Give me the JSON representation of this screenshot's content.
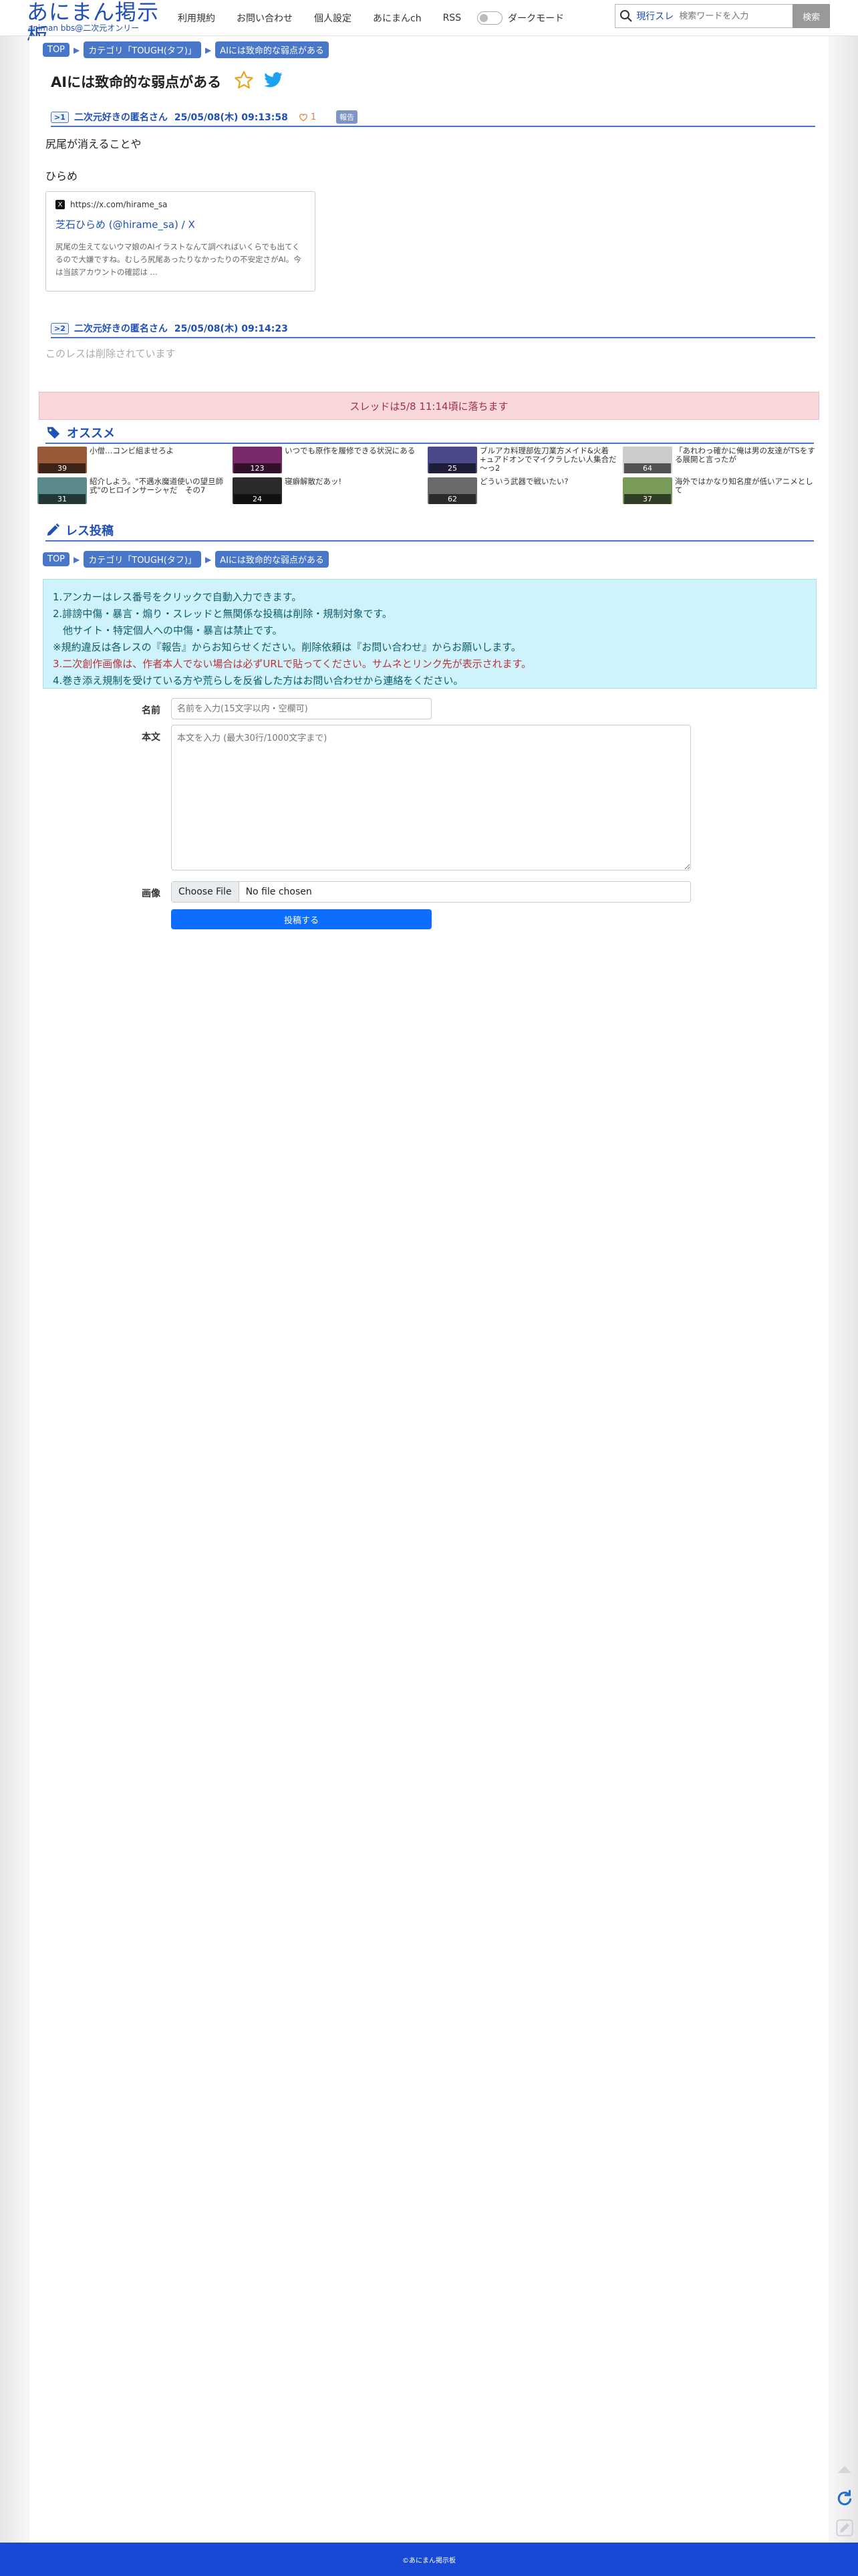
{
  "site": {
    "logo_main": "あにまん掲示板",
    "logo_sub": "animan bbs@二次元オンリー",
    "nav": [
      "利用規約",
      "お問い合わせ",
      "個人設定",
      "あにまんch",
      "RSS"
    ],
    "dark_mode_label": "ダークモード",
    "search": {
      "scope": "現行スレ",
      "placeholder": "検索ワードを入力",
      "button": "検索"
    }
  },
  "breadcrumb": [
    "TOP",
    "カテゴリ「TOUGH(タフ)」",
    "AIには致命的な弱点がある"
  ],
  "thread": {
    "title": "AIには致命的な弱点がある",
    "icons": {
      "favorite": "star-icon",
      "share": "twitter-icon"
    },
    "accent_color": "#4876c8"
  },
  "posts": [
    {
      "num": ">1",
      "author": "二次元好きの匿名さん",
      "date": "25/05/08(木) 09:13:58",
      "likes": "1",
      "report_label": "報告",
      "body_lines": [
        "尻尾が消えることや",
        "ひらめ"
      ],
      "card": {
        "url": "https://x.com/hirame_sa",
        "url_icon": "X",
        "title": "芝石ひらめ (@hirame_sa) / X",
        "desc": "尻尾の生えてないウマ娘のAIイラストなんて調べればいくらでも出てくるので大嫌ですね。むしろ尻尾あったりなかったりの不安定さがAI。今は当該アカウントの確認は ..."
      }
    },
    {
      "num": ">2",
      "author": "二次元好きの匿名さん",
      "date": "25/05/08(木) 09:14:23",
      "deleted": "このレスは削除されています"
    }
  ],
  "notice": "スレッドは5/8 11:14頃に落ちます",
  "recommend": {
    "title": "オススメ",
    "items": [
      {
        "text": "小僧…コンビ組ませろよ",
        "count": "39",
        "color": "#9a5a3a"
      },
      {
        "text": "いつでも原作を履修できる状況にある",
        "count": "123",
        "color": "#7a2a6a"
      },
      {
        "text": "ブルアカ料理部佐刀業方メイド&火着+ュアドオンでマイクラしたい人集合だ～っ2",
        "count": "25",
        "color": "#4a4a8a"
      },
      {
        "text": "「あれわっ確かに俺は男の友達がTSをする展開と言ったが",
        "count": "64",
        "color": "#cccccc"
      },
      {
        "text": "紹介しよう。\"不遇水魔道使いの望旦師式\"のヒロインサーシャだ　その7",
        "count": "31",
        "color": "#5a8a8a"
      },
      {
        "text": "寝癖解散だあッ!",
        "count": "24",
        "color": "#2a2a2a"
      },
      {
        "text": "どういう武器で戦いたい?",
        "count": "62",
        "color": "#6a6a6a"
      },
      {
        "text": "海外ではかなり知名度が低いアニメとして",
        "count": "37",
        "color": "#7a9a5a"
      }
    ]
  },
  "form": {
    "title": "レス投稿",
    "rules": [
      "1.アンカーはレス番号をクリックで自動入力できます。",
      "2.誹謗中傷・暴言・煽り・スレッドと無関係な投稿は削除・規制対象です。",
      "　他サイト・特定個人への中傷・暴言は禁止です。",
      "※規約違反は各レスの『報告』からお知らせください。削除依頼は『お問い合わせ』からお願いします。",
      "3.二次創作画像は、作者本人でない場合は必ずURLで貼ってください。サムネとリンク先が表示されます。",
      "4.巻き添え規制を受けている方や荒らしを反省した方はお問い合わせから連絡をください。"
    ],
    "name_label": "名前",
    "name_placeholder": "名前を入力(15文字以内・空欄可)",
    "body_label": "本文",
    "body_placeholder": "本文を入力 (最大30行/1000文字まで)",
    "image_label": "画像",
    "file_button": "Choose File",
    "file_status": "No file chosen",
    "submit": "投稿する"
  },
  "footer": "©あにまん掲示板",
  "side_tools": [
    "arrow-up-icon",
    "reload-icon",
    "pencil-icon",
    "gear-icon"
  ]
}
